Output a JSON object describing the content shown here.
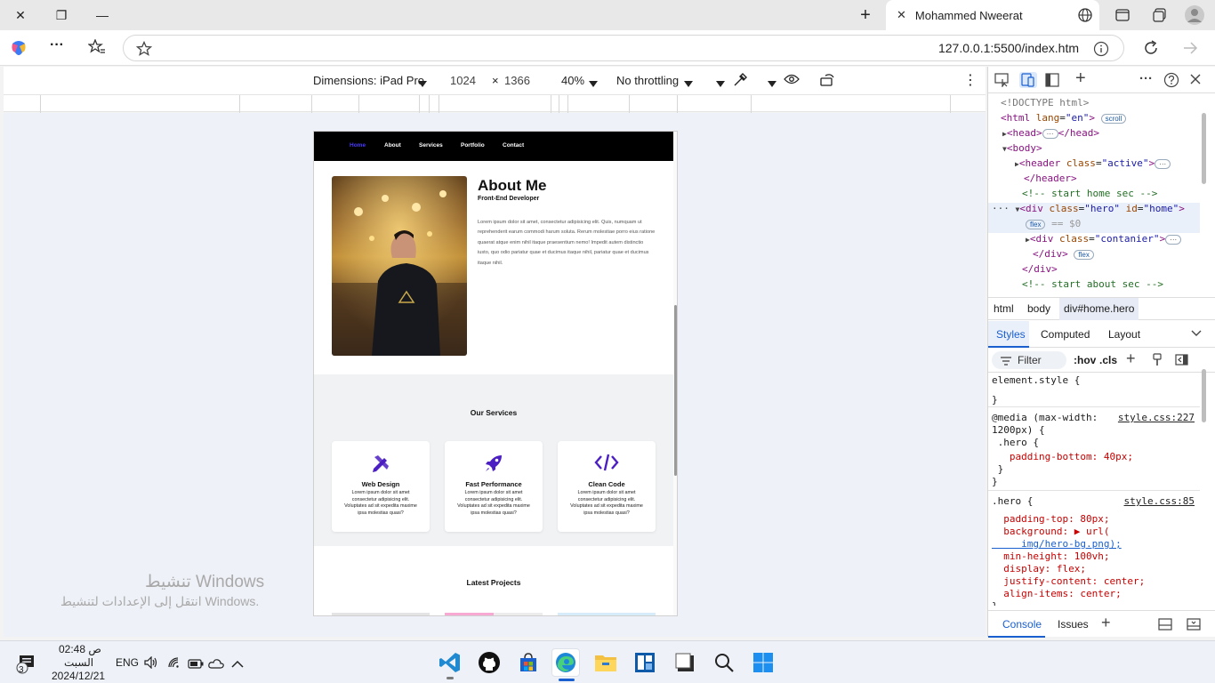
{
  "titlebar": {
    "close_glyph": "✕",
    "restore_glyph": "❐",
    "minimize_glyph": "—",
    "newtab_glyph": "+",
    "tab_close_glyph": "✕",
    "tab_title": "Mohammed Nweerat"
  },
  "address": {
    "more_glyph": "···",
    "url": "127.0.0.1:5500/index.htm"
  },
  "device_toolbar": {
    "dimensions": "Dimensions: iPad Pro",
    "width": "1024",
    "times": "×",
    "height": "1366",
    "zoom": "40%",
    "throttling": "No throttling",
    "more_glyph": "⋮"
  },
  "emulated_page": {
    "nav": [
      "Home",
      "About",
      "Services",
      "Portfolio",
      "Contact"
    ],
    "nav_active_color": "#4a3aff",
    "about": {
      "title": "About Me",
      "subtitle": "Front-End Developer",
      "body": "Lorem ipsum dolor sit amet, consectetur adipisicing elit. Quis, numquam ut reprehenderit earum commodi harum soluta. Rerum molestiae porro eius ratione quaerat atque enim nihil itaque praesentium nemo! Impedit autem distinctio iusto, quo odio pariatur quae et ducimus itaque nihil, pariatur quae et ducimus itaque nihil."
    },
    "services": {
      "title": "Our Services",
      "accent": "#4b1fc2",
      "cards": [
        {
          "icon": "pen-ruler-icon",
          "title": "Web Design",
          "desc": "Lorem ipsum dolor sit amet consectetur adipisicing elit. Voluptates ad sit expedita maxime ipsa molestias quasi?"
        },
        {
          "icon": "rocket-icon",
          "title": "Fast Performance",
          "desc": "Lorem ipsum dolor sit amet consectetur adipisicing elit. Voluptates ad sit expedita maxime ipsa molestias quasi?"
        },
        {
          "icon": "code-icon",
          "title": "Clean Code",
          "desc": "Lorem ipsum dolor sit amet consectetur adipisicing elit. Voluptates ad sit expedita maxime ipsa molestias quasi?"
        }
      ]
    },
    "projects": {
      "title": "Latest Projects"
    }
  },
  "watermark": {
    "line1": "تنشيط Windows",
    "line2": "انتقل إلى الإعدادات لتنشيط Windows."
  },
  "devtools": {
    "elements": [
      {
        "pre": "<!DOCTYPE html>",
        "kind": "doctype"
      },
      {
        "open": "<html",
        "attr": "lang",
        "val": "\"en\"",
        "close": ">",
        "pill": "scroll"
      },
      {
        "text": "<head>",
        "tail": "</head>"
      },
      {
        "text": "<body>"
      },
      {
        "open": "<header",
        "attr": "class",
        "val": "\"active\"",
        "close": ">"
      },
      {
        "text": "</header>"
      },
      {
        "comment": "<!-- start home sec -->"
      },
      {
        "open": "<div",
        "attr": "class",
        "val": "\"hero\"",
        "attr2": "id",
        "val2": "\"home\"",
        "close": ">"
      },
      {
        "pill": "flex",
        "eq": "== $0"
      },
      {
        "open": "<div",
        "attr": "class",
        "val": "\"contanier\"",
        "close": ">"
      },
      {
        "text": "</div>",
        "pill": "flex"
      },
      {
        "text": "</div>"
      },
      {
        "comment": "<!-- start about sec -->"
      }
    ],
    "breadcrumbs": [
      "html",
      "body",
      "div#home.hero"
    ],
    "subtabs": [
      "Styles",
      "Computed",
      "Layout"
    ],
    "filter": {
      "placeholder": "Filter",
      "hov": ":hov",
      "cls": ".cls"
    },
    "styles": [
      "element.style {",
      "}",
      "@media (max-width:",
      "1200px) {",
      " .hero {",
      "   padding-bottom: 40px;",
      " }",
      "}",
      ".hero {",
      "  padding-top: 80px;",
      "  background: ▶ url(",
      "     img/hero-bg.png);",
      "  min-height: 100vh;",
      "  display: flex;",
      "  justify-content: center;",
      "  align-items: center;",
      "}"
    ],
    "links": {
      "media": "style.css:227",
      "hero": "style.css:85"
    },
    "drawer": [
      "Console",
      "Issues"
    ]
  },
  "taskbar": {
    "time": "02:48 ص",
    "day": "السبت",
    "date": "2024/12/21",
    "lang": "ENG",
    "notif_count": "3"
  }
}
